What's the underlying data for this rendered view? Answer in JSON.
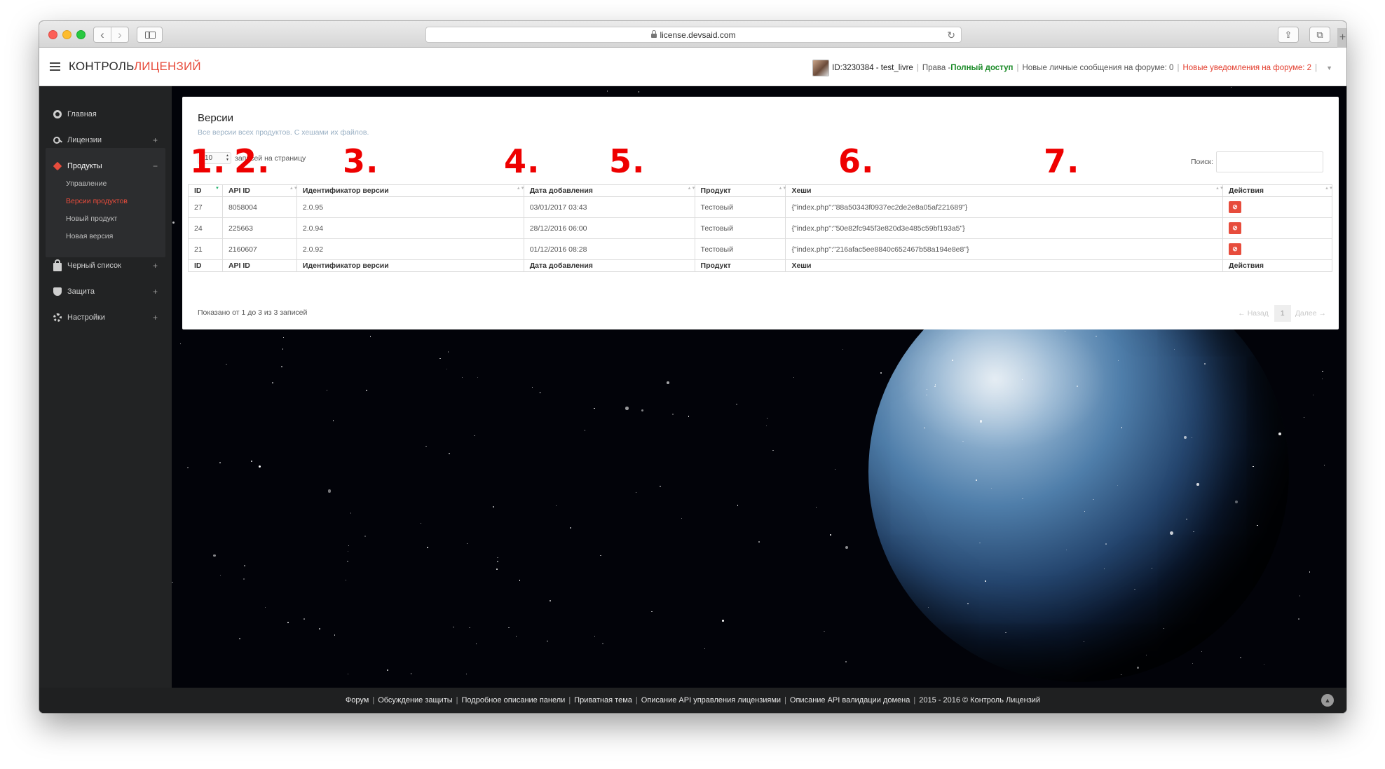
{
  "browser": {
    "url": "license.devsaid.com"
  },
  "header": {
    "logo_part1": "КОНТРОЛЬ",
    "logo_part2": "ЛИЦЕНЗИЙ",
    "user_id": "ID:3230384 - test_livre",
    "rights_label": "Права - ",
    "rights_value": "Полный доступ",
    "messages": "Новые личные сообщения на форуме: 0",
    "notifications": "Новые уведомления на форуме: 2"
  },
  "sidebar": {
    "items": [
      {
        "label": "Главная"
      },
      {
        "label": "Лицензии"
      },
      {
        "label": "Продукты"
      },
      {
        "label": "Черный список"
      },
      {
        "label": "Защита"
      },
      {
        "label": "Настройки"
      }
    ],
    "subitems": [
      {
        "label": "Управление"
      },
      {
        "label": "Версии продуктов"
      },
      {
        "label": "Новый продукт"
      },
      {
        "label": "Новая версия"
      }
    ]
  },
  "panel": {
    "title": "Версии",
    "subtitle": "Все версии всех продуктов. С хешами их файлов.",
    "page_length": "10",
    "page_length_label": "записей на страницу",
    "search_label": "Поиск:",
    "columns": [
      "ID",
      "API ID",
      "Идентификатор версии",
      "Дата добавления",
      "Продукт",
      "Хеши",
      "Действия"
    ],
    "rows": [
      {
        "id": "27",
        "api_id": "8058004",
        "version": "2.0.95",
        "date": "03/01/2017 03:43",
        "product": "Тестовый",
        "hashes": "{\"index.php\":\"88a50343f0937ec2de2e8a05af221689\"}"
      },
      {
        "id": "24",
        "api_id": "225663",
        "version": "2.0.94",
        "date": "28/12/2016 06:00",
        "product": "Тестовый",
        "hashes": "{\"index.php\":\"50e82fc945f3e820d3e485c59bf193a5\"}"
      },
      {
        "id": "21",
        "api_id": "2160607",
        "version": "2.0.92",
        "date": "01/12/2016 08:28",
        "product": "Тестовый",
        "hashes": "{\"index.php\":\"216afac5ee8840c652467b58a194e8e8\"}"
      }
    ],
    "info": "Показано от 1 до 3 из 3 записей",
    "prev": "← Назад",
    "page": "1",
    "next": "Далее →"
  },
  "annotations": [
    "1.",
    "2.",
    "3.",
    "4.",
    "5.",
    "6.",
    "7."
  ],
  "footer": {
    "links": [
      "Форум",
      "Обсуждение защиты",
      "Подробное описание панели",
      "Приватная тема",
      "Описание API управления лицензиями",
      "Описание API валидации домена"
    ],
    "copyright": "2015 - 2016 © Контроль Лицензий"
  },
  "colors": {
    "accent": "#e74c3c",
    "sidebar": "#222324",
    "rights": "#1a8a27"
  },
  "icons": [
    "dashboard-icon",
    "key-icon",
    "tag-icon",
    "lock-icon",
    "shield-icon",
    "cogs-icon",
    "ban-icon"
  ]
}
